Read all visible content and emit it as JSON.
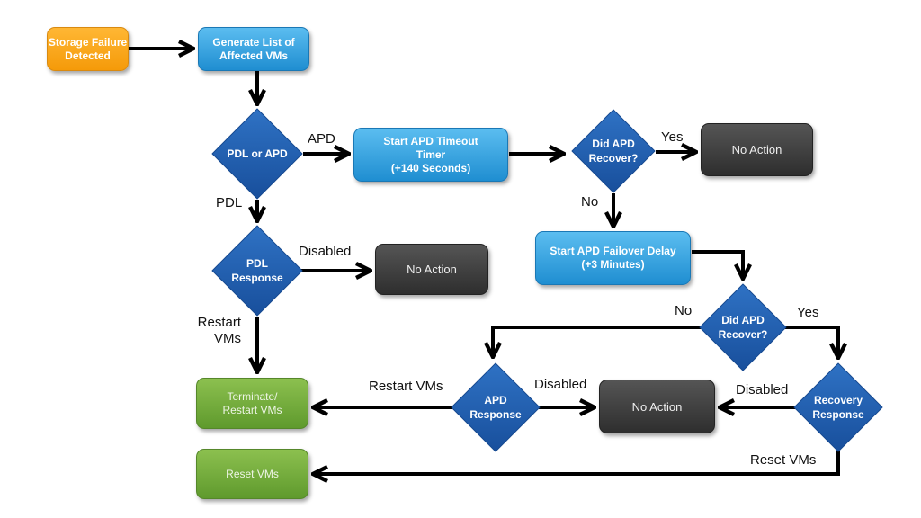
{
  "diagram": {
    "colors": {
      "start": "#f7a21b",
      "process": "#2fa0dd",
      "decision": "#1f5eb0",
      "no_action": "#3a3a3a",
      "outcome": "#6fa83a",
      "edge": "#000000"
    },
    "nodes": {
      "storage_failure": "Storage Failure Detected",
      "generate_list": "Generate List of Affected VMs",
      "pdl_or_apd": "PDL or APD",
      "apd_timeout": [
        "Start APD Timeout",
        "Timer",
        "(+140 Seconds)"
      ],
      "did_apd_recover_1": [
        "Did APD",
        "Recover?"
      ],
      "no_action_1": "No Action",
      "pdl_response": [
        "PDL",
        "Response"
      ],
      "no_action_2": "No Action",
      "apd_failover": [
        "Start APD Failover Delay",
        "(+3 Minutes)"
      ],
      "did_apd_recover_2": [
        "Did APD",
        "Recover?"
      ],
      "apd_response": [
        "APD",
        "Response"
      ],
      "no_action_3": "No Action",
      "recovery_response": [
        "Recovery",
        "Response"
      ],
      "terminate_restart": [
        "Terminate/",
        "Restart VMs"
      ],
      "reset_vms": "Reset VMs"
    },
    "edge_labels": {
      "apd": "APD",
      "pdl": "PDL",
      "yes_1": "Yes",
      "no_1": "No",
      "disabled_pdl": "Disabled",
      "restart_vms_pdl": [
        "Restart",
        "VMs"
      ],
      "no_2": "No",
      "yes_2": "Yes",
      "restart_vms_apd": "Restart VMs",
      "disabled_apd": "Disabled",
      "disabled_recovery": "Disabled",
      "reset_vms": "Reset VMs"
    }
  }
}
